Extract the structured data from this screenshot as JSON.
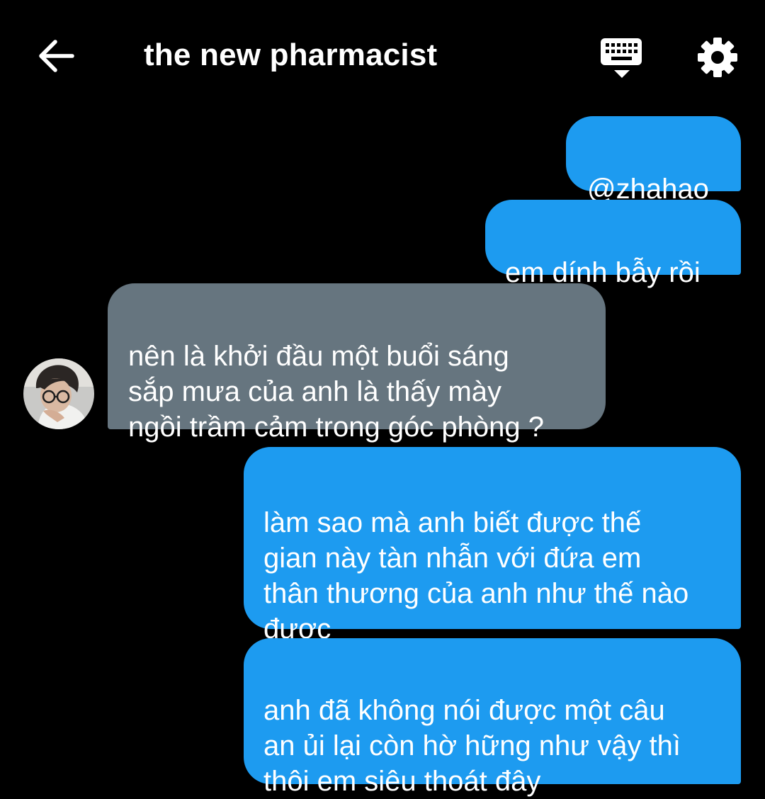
{
  "header": {
    "title": "the new pharmacist",
    "back_icon": "arrow-left-icon",
    "keyboard_icon": "keyboard-hide-icon",
    "settings_icon": "gear-icon"
  },
  "colors": {
    "background": "#000000",
    "sent_bubble": "#1d9bf0",
    "received_bubble": "#66757f",
    "text": "#ffffff"
  },
  "messages": [
    {
      "direction": "sent",
      "text": "@zhahao"
    },
    {
      "direction": "sent",
      "text": "em dính bẫy rồi"
    },
    {
      "direction": "received",
      "text": "nên là khởi đầu một buổi sáng\nsắp mưa của anh là thấy mày\nngồi trầm cảm trong góc phòng ?"
    },
    {
      "direction": "sent",
      "text": "làm sao mà anh biết được thế\ngian này tàn nhẫn với đứa em\nthân thương của anh như thế nào\nđược"
    },
    {
      "direction": "sent",
      "text": "anh đã không nói được một câu\nan ủi lại còn hờ hững như vậy thì\nthôi em siêu thoát đây"
    }
  ]
}
